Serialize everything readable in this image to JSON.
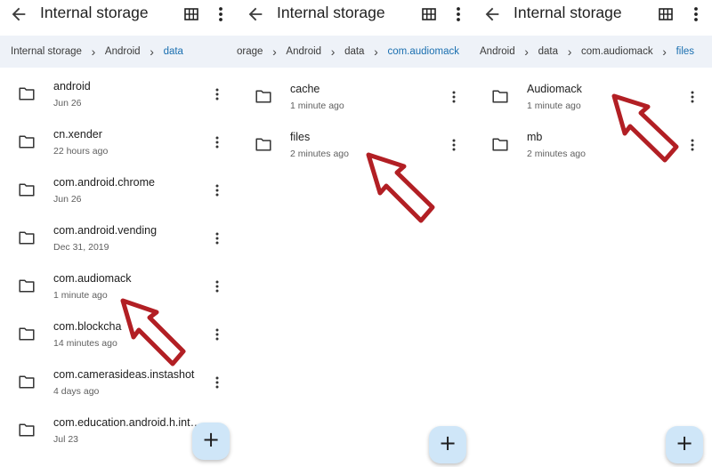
{
  "panels": [
    {
      "title": "Internal storage",
      "breadcrumbs": [
        "Internal storage",
        "Android",
        "data"
      ],
      "items": [
        {
          "name": "android",
          "time": "Jun 26"
        },
        {
          "name": "cn.xender",
          "time": "22 hours ago"
        },
        {
          "name": "com.android.chrome",
          "time": "Jun 26"
        },
        {
          "name": "com.android.vending",
          "time": "Dec 31, 2019"
        },
        {
          "name": "com.audiomack",
          "time": "1 minute ago"
        },
        {
          "name": "com.blockcha",
          "time": "14 minutes ago"
        },
        {
          "name": "com.camerasideas.instashot",
          "time": "4 days ago"
        },
        {
          "name": "com.education.android.h.int…",
          "time": "Jul 23"
        }
      ]
    },
    {
      "title": "Internal storage",
      "breadcrumbs": [
        "orage",
        "Android",
        "data",
        "com.audiomack"
      ],
      "items": [
        {
          "name": "cache",
          "time": "1 minute ago"
        },
        {
          "name": "files",
          "time": "2 minutes ago"
        }
      ]
    },
    {
      "title": "Internal storage",
      "breadcrumbs": [
        "Android",
        "data",
        "com.audiomack",
        "files"
      ],
      "items": [
        {
          "name": "Audiomack",
          "time": "1 minute ago"
        },
        {
          "name": "mb",
          "time": "2 minutes ago"
        }
      ]
    }
  ],
  "icons": {
    "back": "arrow-back-icon",
    "grid": "grid-view-icon",
    "more": "more-vert-icon",
    "folder": "folder-icon",
    "add": "add-icon"
  },
  "fab_symbol": "+",
  "breadcrumb_separator": "›",
  "colors": {
    "breadcrumb_bg": "#eef2f8",
    "breadcrumb_active": "#1a6fb0",
    "fab_bg": "#cfe6f8",
    "annotation_arrow": "#b21f24"
  }
}
